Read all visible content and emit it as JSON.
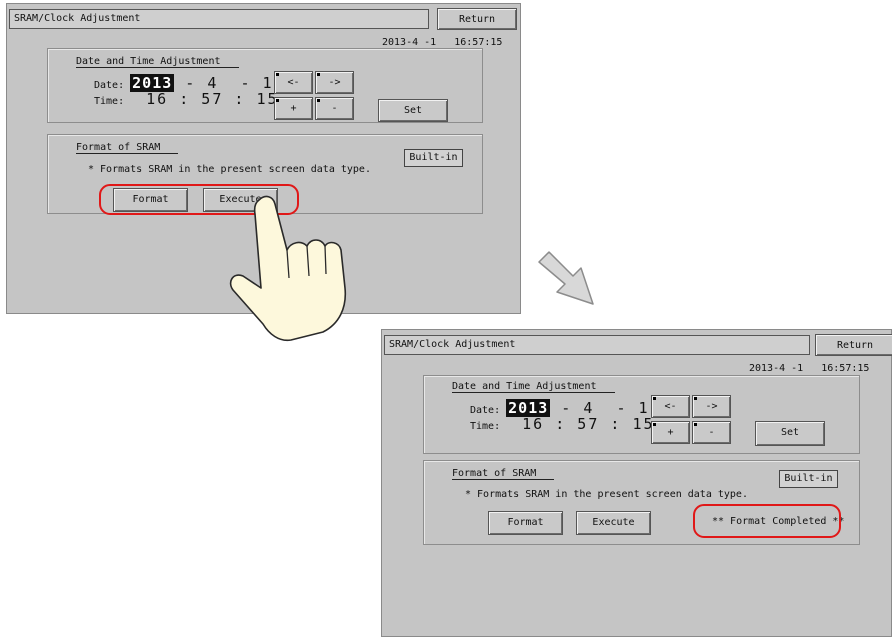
{
  "screens": [
    {
      "title": "SRAM/Clock Adjustment",
      "return_label": "Return",
      "clock_date": "2013-4 -1",
      "clock_time": "16:57:15",
      "dt_panel": {
        "title": "Date and Time Adjustment",
        "date_label": "Date:",
        "year": "2013",
        "month_day": " - 4  - 1",
        "time_label": "Time:",
        "time_value": "16 : 57 : 15",
        "left_label": "<-",
        "right_label": "->",
        "plus_label": "+",
        "minus_label": "-",
        "set_label": "Set"
      },
      "format_panel": {
        "title": "Format of SRAM",
        "hint": "* Formats SRAM in the present screen data type.",
        "builtin_label": "Built-in",
        "format_label": "Format",
        "execute_label": "Execute"
      }
    },
    {
      "title": "SRAM/Clock Adjustment",
      "return_label": "Return",
      "clock_date": "2013-4 -1",
      "clock_time": "16:57:15",
      "dt_panel": {
        "title": "Date and Time Adjustment",
        "date_label": "Date:",
        "year": "2013",
        "month_day": " - 4  - 1",
        "time_label": "Time:",
        "time_value": "16 : 57 : 15",
        "left_label": "<-",
        "right_label": "->",
        "plus_label": "+",
        "minus_label": "-",
        "set_label": "Set"
      },
      "format_panel": {
        "title": "Format of SRAM",
        "hint": "* Formats SRAM in the present screen data type.",
        "builtin_label": "Built-in",
        "format_label": "Format",
        "execute_label": "Execute",
        "status": "** Format Completed **"
      }
    }
  ],
  "colors": {
    "screen_bg": "#c5c5c5",
    "highlight": "#e01818",
    "hand_fill": "#fdf8dc",
    "arrow_fill": "#d8d8d8"
  },
  "icons": [
    "pointing-hand-icon",
    "down-right-arrow-icon"
  ]
}
